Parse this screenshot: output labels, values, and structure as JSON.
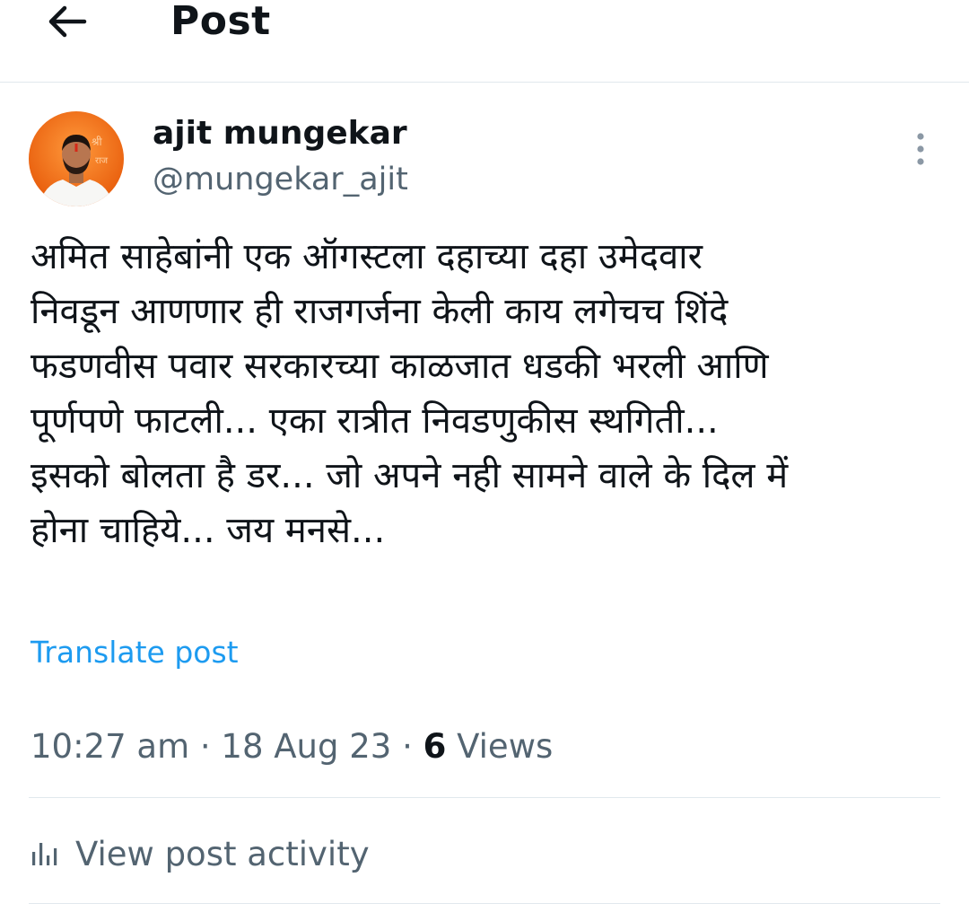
{
  "header": {
    "title": "Post",
    "back_icon": "arrow-left-icon"
  },
  "author": {
    "display_name": "ajit mungekar",
    "handle": "@mungekar_ajit",
    "avatar_icon": "user-avatar",
    "avatar_bg": "#f26b1d"
  },
  "more_icon": "vertical-dots-icon",
  "post": {
    "lines": [
      "अमित साहेबांनी एक ऑगस्टला दहाच्या दहा उमेदवार",
      "निवडून आणणार ही राजगर्जना केली काय लगेचच शिंदे",
      "फडणवीस पवार सरकारच्या काळजात धडकी भरली आणि",
      "पूर्णपणे फाटली... एका रात्रीत निवडणुकीस स्थगिती...",
      "इसको बोलता है डर... जो अपने नही सामने वाले के दिल में",
      "होना चाहिये... जय मनसे..."
    ]
  },
  "translate_label": "Translate post",
  "meta": {
    "time": "10:27 am",
    "separator": " · ",
    "date": "18 Aug 23",
    "views_count": "6",
    "views_label": " Views"
  },
  "activity": {
    "icon": "bar-chart-icon",
    "label": "View post activity"
  },
  "colors": {
    "accent": "#1d9bf0",
    "text_primary": "#0f1419",
    "text_secondary": "#536471",
    "divider": "#e1e8ed"
  }
}
